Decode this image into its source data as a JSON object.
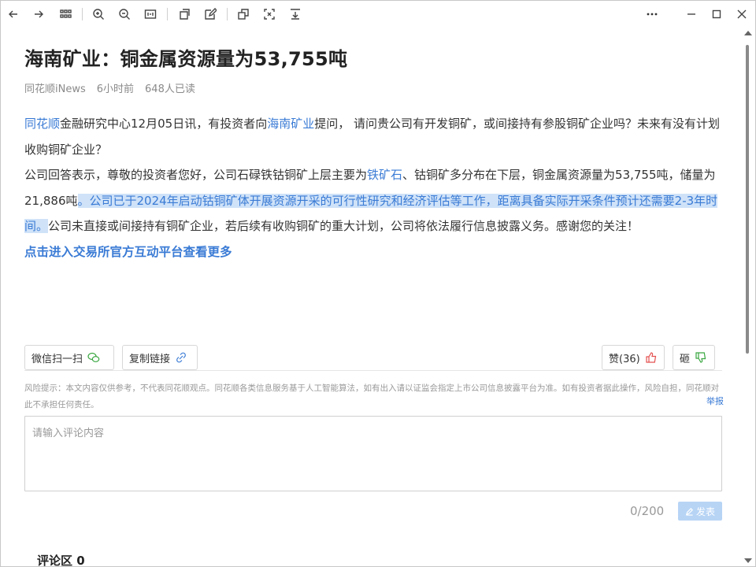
{
  "toolbar": {
    "icons": [
      "back-arrow-icon",
      "forward-arrow-icon",
      "apps-grid-icon",
      "zoom-in-icon",
      "zoom-out-icon",
      "fit-width-icon",
      "new-window-icon",
      "edit-icon",
      "copy-icon",
      "screenshot-icon",
      "download-icon",
      "more-icon",
      "minimize-icon",
      "maximize-icon",
      "close-icon"
    ]
  },
  "article": {
    "title": "海南矿业：铜金属资源量为53,755吨",
    "source": "同花顺iNews",
    "time": "6小时前",
    "reads": "648人已读",
    "p1": {
      "link1": "同花顺",
      "t1": "金融研究中心12月05日讯，有投资者向",
      "link2": "海南矿业",
      "t2": "提问， 请问贵公司有开发铜矿，或间接持有参股铜矿企业吗？未来有没有计划收购铜矿企业？"
    },
    "p2": {
      "t1": "公司回答表示，尊敬的投资者您好，公司石碌铁钴铜矿上层主要为",
      "link": "铁矿石",
      "t2": "、钴铜矿多分布在下层，铜金属资源量为53,755吨，储量为21,886吨",
      "highlight": "。公司已于2024年启动钴铜矿体开展资源开采的可行性研究和经济评估等工作，距离具备实际开采条件预计还需要2-3年时间。",
      "t3": "公司未直接或间接持有铜矿企业，若后续有收购铜矿的重大计划，公司将依法履行信息披露义务。感谢您的关注！"
    },
    "more_link": "点击进入交易所官方互动平台查看更多"
  },
  "actions": {
    "wechat_label": "微信扫一扫",
    "copy_label": "复制链接",
    "like_label": "赞(36)",
    "dislike_label": "砸"
  },
  "risk": {
    "text": "风险提示：本文内容仅供参考，不代表同花顺观点。同花顺各类信息服务基于人工智能算法，如有出入请以证监会指定上市公司信息披露平台为准。如有投资者据此操作，风险自担，同花顺对此不承担任何责任。",
    "report_label": "举报"
  },
  "comment": {
    "placeholder": "请输入评论内容",
    "value": "",
    "counter": "0/200",
    "post_label": "发表",
    "section_title": "评论区 0"
  },
  "colors": {
    "link": "#3a7bd5",
    "highlight_bg": "#cfe2f8",
    "post_button": "#b7d4f5",
    "like_icon": "#e55050",
    "dislike_icon": "#3aa640",
    "wechat_icon": "#3aa640"
  }
}
